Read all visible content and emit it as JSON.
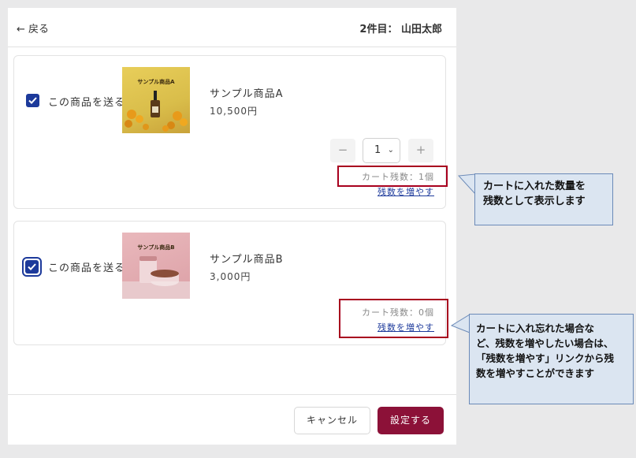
{
  "header": {
    "back_label": "← 戻る",
    "count_label": "2件目： 山田太郎"
  },
  "items": [
    {
      "send_label": "この商品を送る",
      "thumb_text": "サンプル商品A",
      "name": "サンプル商品A",
      "price": "10,500円",
      "qty": {
        "minus": "−",
        "value": "1",
        "plus": "+"
      },
      "stock": "カート残数：1個",
      "increase_link": "残数を増やす"
    },
    {
      "send_label": "この商品を送る",
      "thumb_text": "サンプル商品B",
      "name": "サンプル商品B",
      "price": "3,000円",
      "stock": "カート残数：0個",
      "increase_link": "残数を増やす"
    }
  ],
  "footer": {
    "cancel_label": "キャンセル",
    "confirm_label": "設定する"
  },
  "callouts": [
    {
      "lines": [
        "カートに入れた数量を",
        "残数として表示します"
      ]
    },
    {
      "lines": [
        "カートに入れ忘れた場合な",
        "ど、残数を増やしたい場合は、",
        "「残数を増やす」リンクから残",
        "数を増やすことができます"
      ]
    }
  ],
  "colors": {
    "accent": "#8c1138",
    "checkbox": "#1d3a9b",
    "highlight": "#a8001e",
    "callout_bg": "#dbe5f1"
  }
}
